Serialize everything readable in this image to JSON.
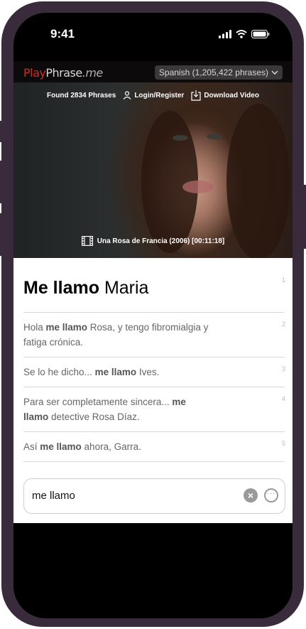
{
  "status": {
    "time": "9:41"
  },
  "header": {
    "logo": {
      "play": "Play",
      "phrase": "Phrase",
      "me": ".me"
    },
    "language": "Spanish (1,205,422 phrases)"
  },
  "video": {
    "found": "Found 2834 Phrases",
    "login": "Login/Register",
    "download": "Download Video",
    "caption": "Una Rosa de Francia (2006) [00:11:18]"
  },
  "main": {
    "phrase_bold": "Me llamo",
    "phrase_rest": "Maria",
    "number": "1"
  },
  "results": [
    {
      "pre": "Hola ",
      "bold": "me llamo",
      "post": " Rosa, y tengo fibromialgia y fatiga crónica.",
      "number": "2"
    },
    {
      "pre": "Se lo he dicho... ",
      "bold": "me llamo",
      "post": " Ives.",
      "number": "3"
    },
    {
      "pre": "Para ser completamente sincera... ",
      "bold": "me llamo",
      "post": " detective Rosa Díaz.",
      "number": "4"
    },
    {
      "pre": "Así ",
      "bold": "me llamo",
      "post": " ahora, Garra.",
      "number": "5"
    }
  ],
  "search": {
    "value": "me llamo"
  }
}
